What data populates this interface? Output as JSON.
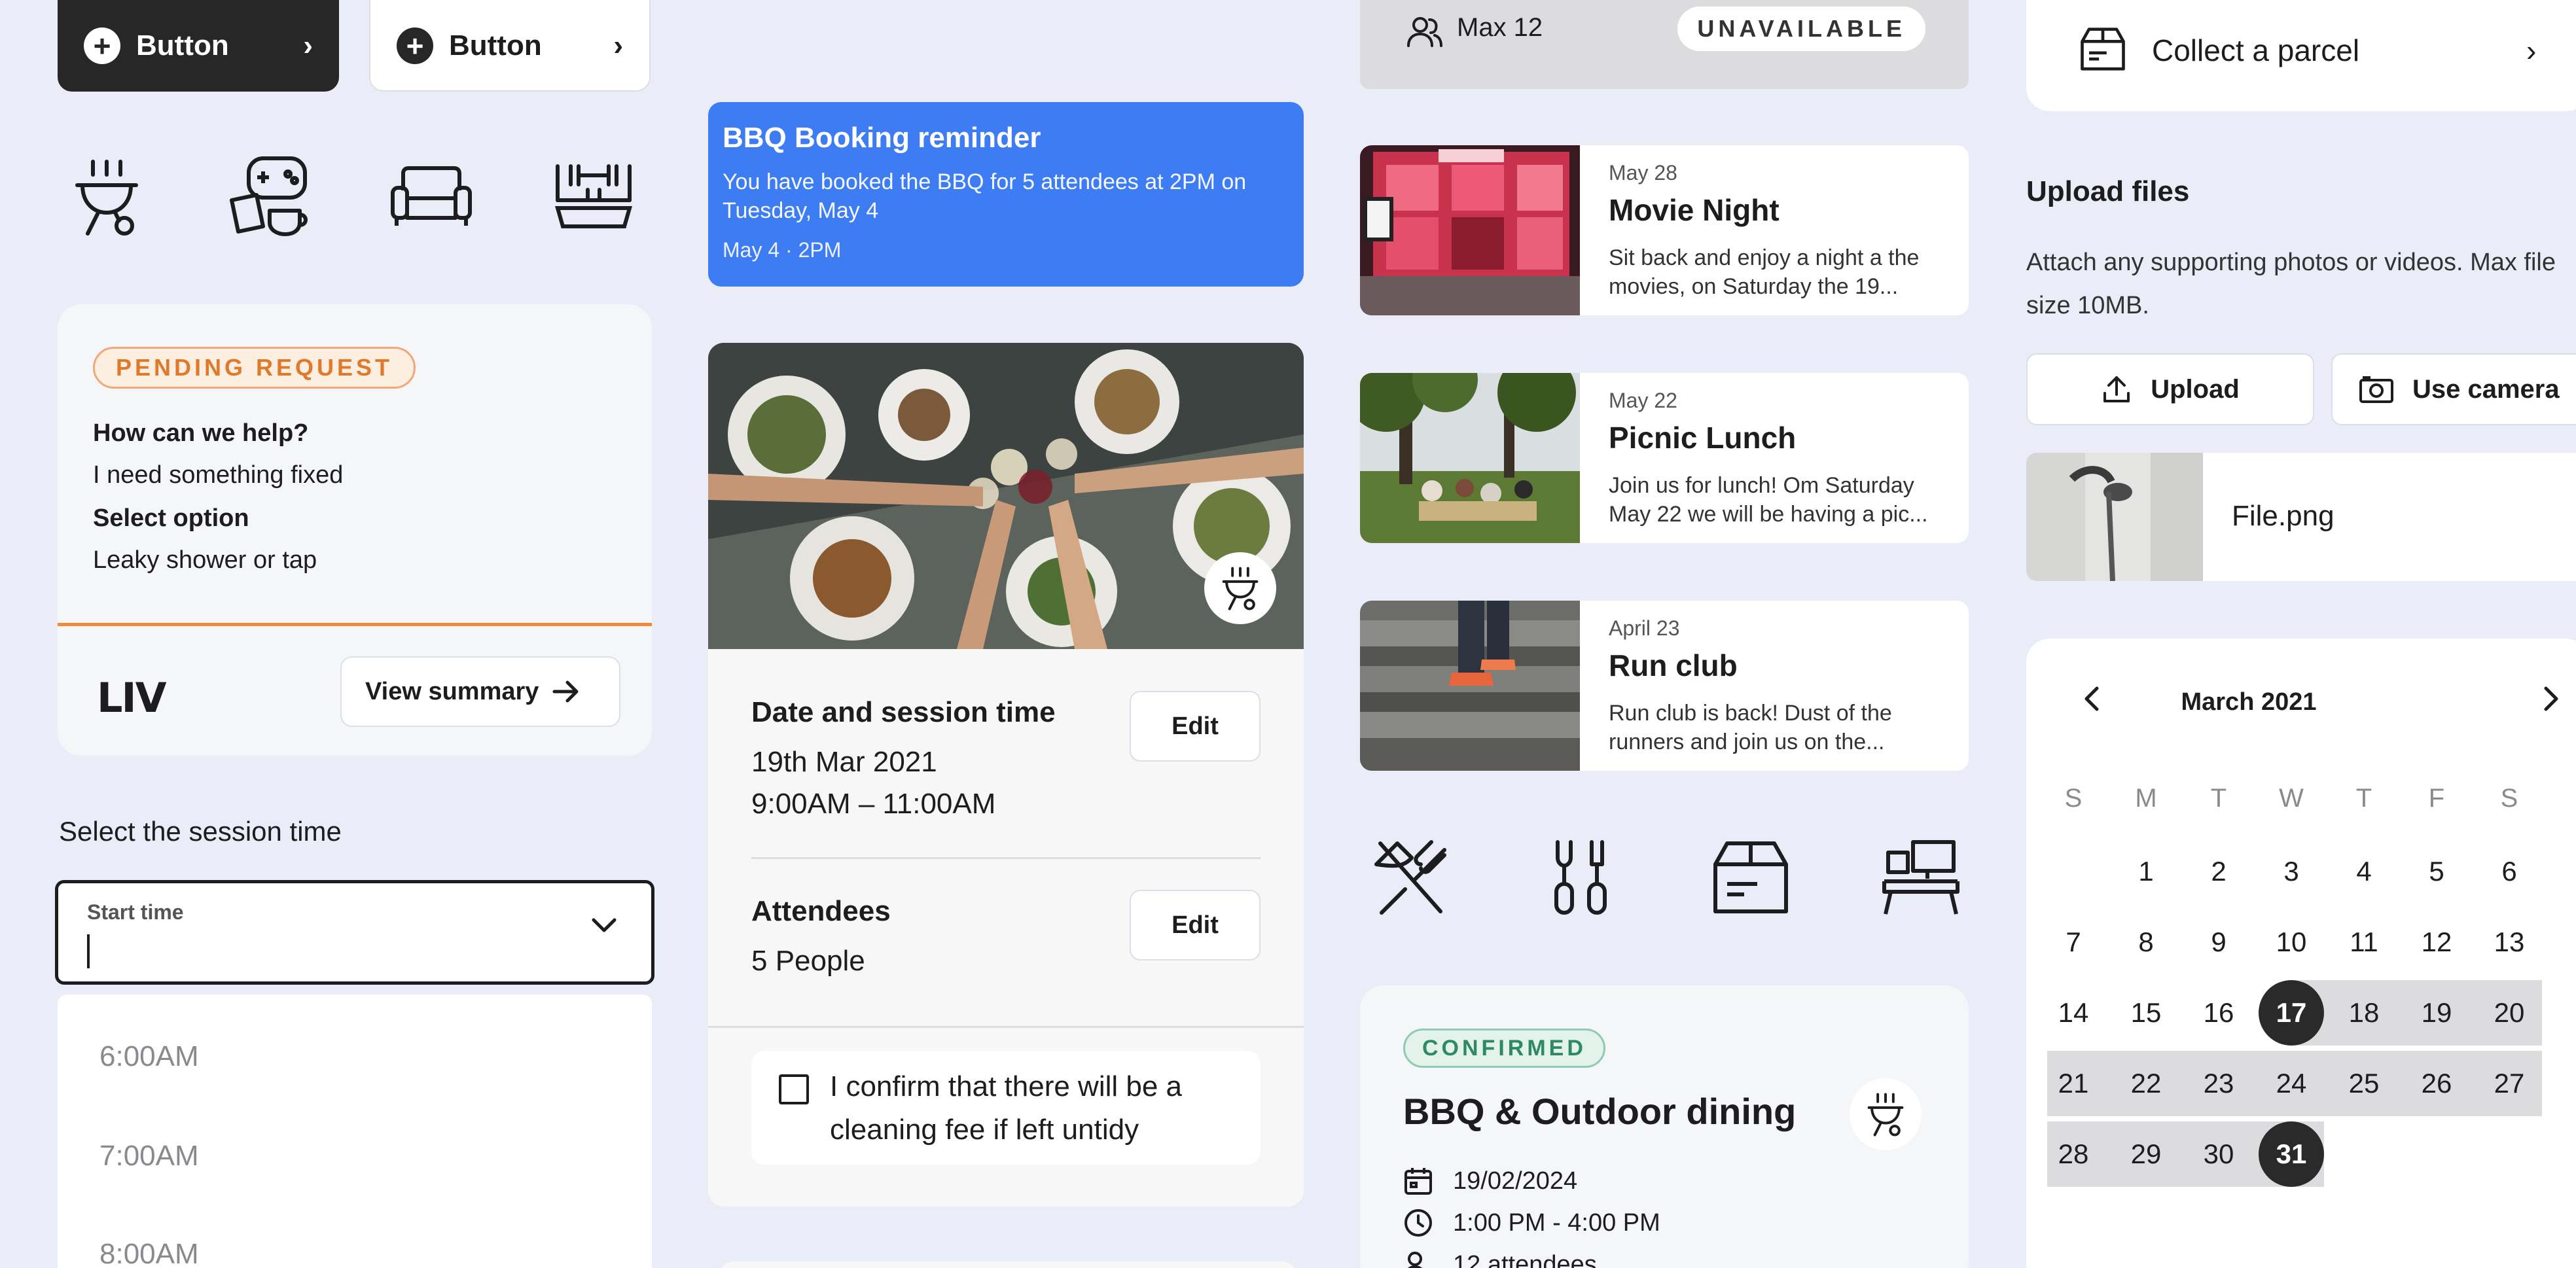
{
  "buttons": {
    "primary_label": "Button",
    "secondary_label": "Button"
  },
  "pending": {
    "badge": "PENDING REQUEST",
    "q1_label": "How can we help?",
    "q1_value": "I need something fixed",
    "q2_label": "Select option",
    "q2_value": "Leaky shower or tap",
    "logo": "LIV",
    "view_summary": "View summary"
  },
  "session": {
    "label": "Select the session time",
    "start_label": "Start time",
    "start_value": "",
    "options": [
      "6:00AM",
      "7:00AM",
      "8:00AM"
    ]
  },
  "reminder": {
    "title": "BBQ Booking reminder",
    "body": "You have booked the BBQ for 5 attendees at 2PM on Tuesday, May 4",
    "date": "May 4 · 2PM"
  },
  "booking": {
    "date_heading": "Date and session time",
    "date_value": "19th Mar 2021",
    "time_value": "9:00AM – 11:00AM",
    "attendees_heading": "Attendees",
    "attendees_value": "5 People",
    "edit_label": "Edit",
    "confirm_text": "I confirm that there will be a cleaning fee if left untidy"
  },
  "capacity": {
    "max": "Max 12",
    "status": "UNAVAILABLE"
  },
  "events": [
    {
      "date": "May 28",
      "title": "Movie Night",
      "desc": "Sit back and enjoy a night a the movies, on Saturday the 19..."
    },
    {
      "date": "May 22",
      "title": "Picnic Lunch",
      "desc": "Join us for lunch! Om Saturday May 22 we will be having a pic..."
    },
    {
      "date": "April 23",
      "title": "Run club",
      "desc": "Run club is back! Dust of the runners and join us on the..."
    }
  ],
  "dining": {
    "badge": "CONFIRMED",
    "title": "BBQ & Outdoor dining",
    "date": "19/02/2024",
    "time": "1:00 PM - 4:00 PM",
    "attendees": "12 attendees"
  },
  "parcel": {
    "label": "Collect a parcel"
  },
  "upload": {
    "title": "Upload files",
    "desc": "Attach any supporting photos or videos. Max file size 10MB.",
    "upload_label": "Upload",
    "camera_label": "Use camera",
    "file_name": "File.png"
  },
  "calendar": {
    "month": "March 2021",
    "dow": [
      "S",
      "M",
      "T",
      "W",
      "T",
      "F",
      "S"
    ],
    "days": [
      "1",
      "2",
      "3",
      "4",
      "5",
      "6",
      "7",
      "8",
      "9",
      "10",
      "11",
      "12",
      "13",
      "14",
      "15",
      "16",
      "17",
      "18",
      "19",
      "20",
      "21",
      "22",
      "23",
      "24",
      "25",
      "26",
      "27",
      "28",
      "29",
      "30",
      "31"
    ],
    "range_start": "17",
    "range_end": "31"
  },
  "colors": {
    "background": "#eaedf7",
    "accent_blue": "#3d7cf3",
    "pending_orange": "#e07a2b",
    "confirmed_green": "#2d8a66",
    "dark": "#272727"
  }
}
